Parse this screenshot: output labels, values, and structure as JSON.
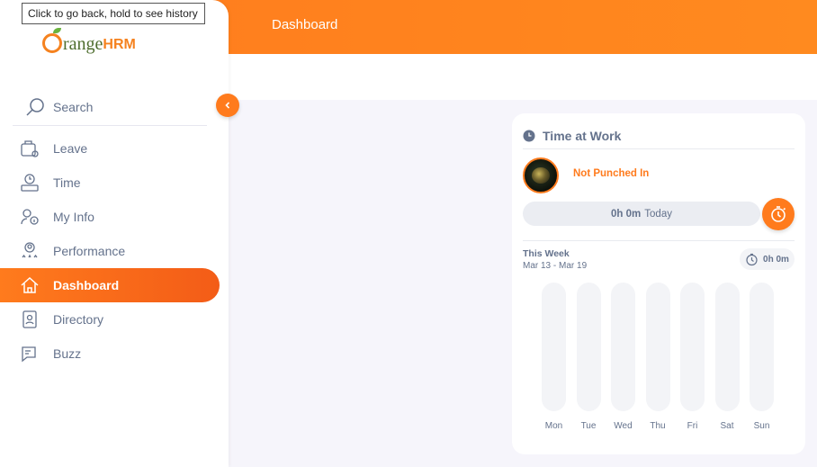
{
  "tooltip": "Click to go back, hold to see history",
  "header": {
    "title": "Dashboard"
  },
  "logo": {
    "part1": "range",
    "part2": "HRM"
  },
  "sidebar": {
    "search_label": "Search",
    "items": [
      {
        "label": "Leave",
        "icon": "leave-icon",
        "active": false
      },
      {
        "label": "Time",
        "icon": "time-icon",
        "active": false
      },
      {
        "label": "My Info",
        "icon": "my-info-icon",
        "active": false
      },
      {
        "label": "Performance",
        "icon": "performance-icon",
        "active": false
      },
      {
        "label": "Dashboard",
        "icon": "home-icon",
        "active": true
      },
      {
        "label": "Directory",
        "icon": "directory-icon",
        "active": false
      },
      {
        "label": "Buzz",
        "icon": "buzz-icon",
        "active": false
      }
    ]
  },
  "time_at_work": {
    "title": "Time at Work",
    "status": "Not Punched In",
    "today_value": "0h 0m",
    "today_label": "Today",
    "week_title": "This Week",
    "week_range": "Mar 13 - Mar 19",
    "week_total": "0h 0m",
    "days": [
      "Mon",
      "Tue",
      "Wed",
      "Thu",
      "Fri",
      "Sat",
      "Sun"
    ]
  },
  "colors": {
    "accent": "#ff7b1d",
    "text": "#64728c",
    "background": "#f6f5fb"
  }
}
